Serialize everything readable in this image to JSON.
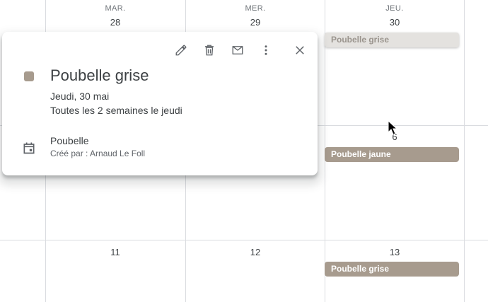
{
  "header": {
    "days": [
      {
        "dow": "MAR.",
        "num": "28"
      },
      {
        "dow": "MER.",
        "num": "29"
      },
      {
        "dow": "JEU.",
        "num": "30"
      }
    ]
  },
  "week2": {
    "jeu_num": "6"
  },
  "week3": {
    "nums": [
      "11",
      "12",
      "13"
    ]
  },
  "events": {
    "e1": "Poubelle grise",
    "e2": "Poubelle jaune",
    "e3": "Poubelle grise"
  },
  "popup": {
    "title": "Poubelle grise",
    "date": "Jeudi, 30 mai",
    "recurrence": "Toutes les 2 semaines le jeudi",
    "calendar_name": "Poubelle",
    "creator": "Créé par : Arnaud Le Foll",
    "toolbar_icons": [
      "edit-icon",
      "delete-icon",
      "email-icon",
      "more-options-icon",
      "close-icon"
    ]
  },
  "colors": {
    "event": "#a79b8e",
    "event_selected": "#e4e2df",
    "grid_line": "#dadce0"
  }
}
